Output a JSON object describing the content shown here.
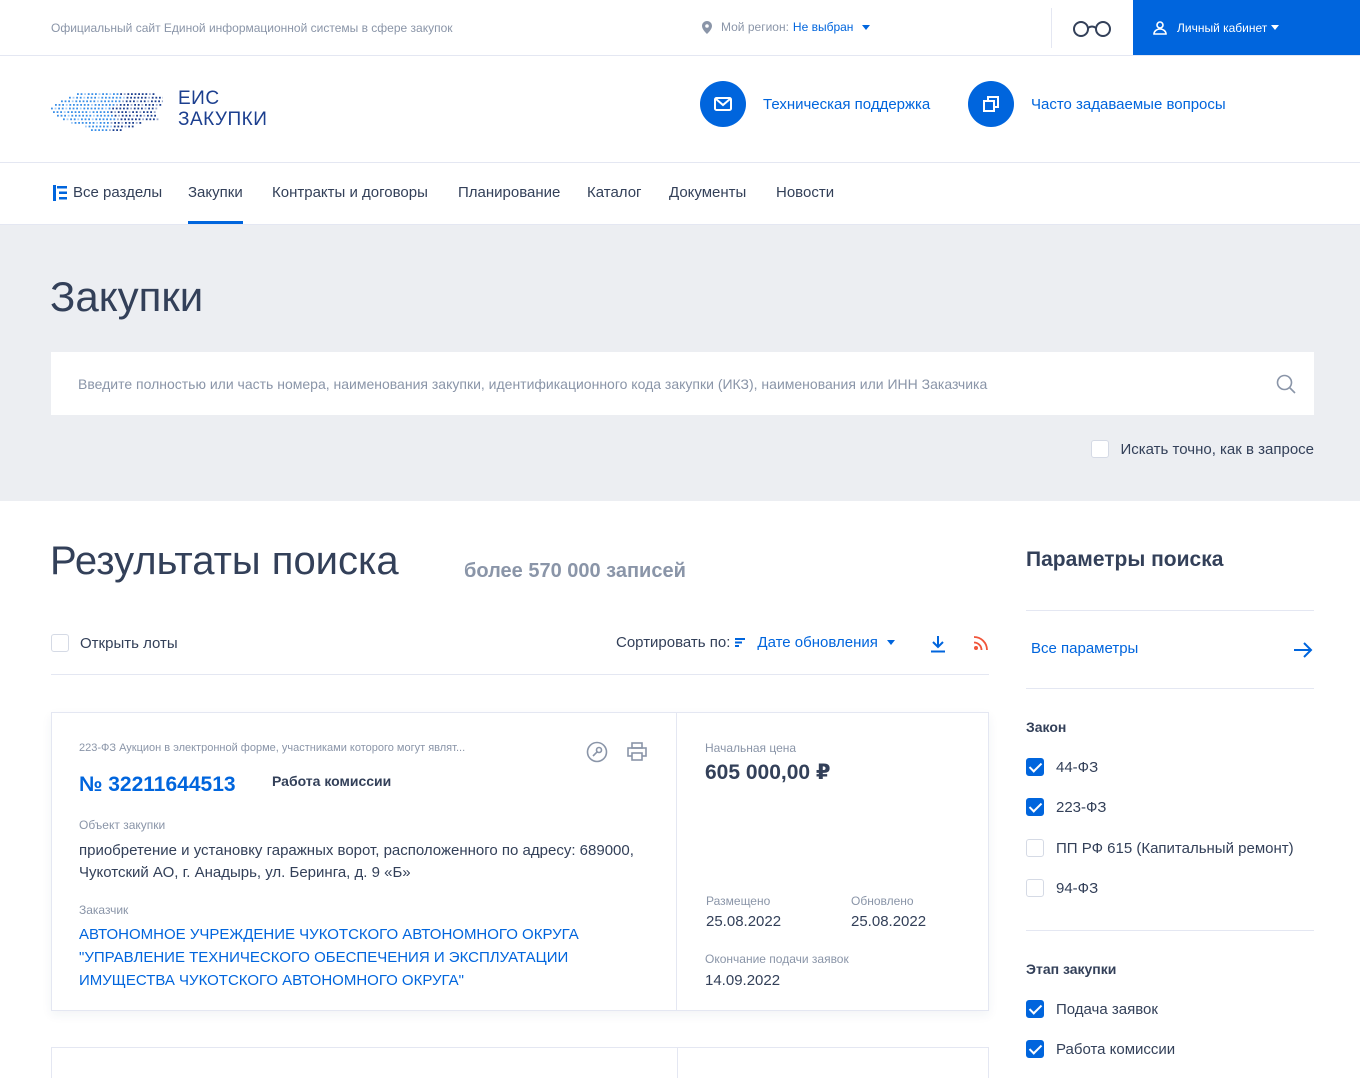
{
  "topbar": {
    "site_caption": "Официальный сайт Единой информационной системы в сфере закупок",
    "region_label": "Мой регион:",
    "region_value": "Не выбран",
    "cabinet_label": "Личный кабинет"
  },
  "header": {
    "logo_line1": "ЕИС",
    "logo_line2": "ЗАКУПКИ",
    "support_label": "Техническая поддержка",
    "faq_label": "Часто задаваемые вопросы"
  },
  "nav": {
    "all_sections": "Все разделы",
    "items": [
      "Закупки",
      "Контракты и договоры",
      "Планирование",
      "Каталог",
      "Документы",
      "Новости"
    ],
    "active_index": 0
  },
  "hero": {
    "title": "Закупки",
    "search_placeholder": "Введите полностью или часть номера, наименования закупки, идентификационного кода закупки (ИКЗ), наименования или ИНН Заказчика",
    "exact_label": "Искать точно, как в запросе",
    "exact_checked": false
  },
  "results": {
    "title": "Результаты поиска",
    "count": "более 570 000 записей",
    "open_lots_label": "Открыть лоты",
    "sort_label": "Сортировать по:",
    "sort_value": "Дате обновления"
  },
  "cards": [
    {
      "type": "223-ФЗ Аукцион в электронной форме, участниками которого могут являт...",
      "number": "№ 32211644513",
      "stage": "Работа комиссии",
      "object_label": "Объект закупки",
      "object": "приобретение и установку гаражных ворот, расположенного по адресу: 689000, Чукотский АО, г. Анадырь, ул. Беринга, д. 9 «Б»",
      "customer_label": "Заказчик",
      "customer": "АВТОНОМНОЕ УЧРЕЖДЕНИЕ ЧУКОТСКОГО АВТОНОМНОГО ОКРУГА \"УПРАВЛЕНИЕ ТЕХНИЧЕСКОГО ОБЕСПЕЧЕНИЯ И ЭКСПЛУАТАЦИИ ИМУЩЕСТВА ЧУКОТСКОГО АВТОНОМНОГО ОКРУГА\"",
      "price_label": "Начальная цена",
      "price": "605 000,00 ₽",
      "placed_label": "Размещено",
      "placed": "25.08.2022",
      "updated_label": "Обновлено",
      "updated": "25.08.2022",
      "deadline_label": "Окончание подачи заявок",
      "deadline": "14.09.2022"
    }
  ],
  "sidebar": {
    "title": "Параметры поиска",
    "all_params": "Все параметры",
    "law_title": "Закон",
    "laws": [
      {
        "label": "44-ФЗ",
        "checked": true
      },
      {
        "label": "223-ФЗ",
        "checked": true
      },
      {
        "label": "ПП РФ 615 (Капитальный ремонт)",
        "checked": false
      },
      {
        "label": "94-ФЗ",
        "checked": false
      }
    ],
    "stage_title": "Этап закупки",
    "stages": [
      {
        "label": "Подача заявок",
        "checked": true
      },
      {
        "label": "Работа комиссии",
        "checked": true
      }
    ]
  },
  "colors": {
    "accent": "#0065dd",
    "text": "#334059",
    "muted": "#8a95a8",
    "hero_bg": "#eceef2",
    "rss": "#f0553a"
  }
}
